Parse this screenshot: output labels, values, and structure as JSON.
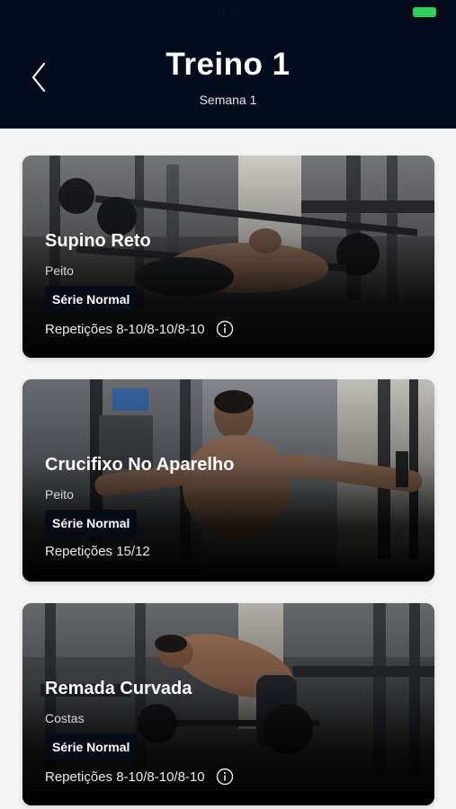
{
  "status": {
    "time": "11:09"
  },
  "header": {
    "title": "Treino 1",
    "subtitle": "Semana 1"
  },
  "exercises": [
    {
      "name": "Supino Reto",
      "muscle": "Peito",
      "series_type": "Série Normal",
      "reps": "Repetições 8-10/8-10/8-10",
      "has_info": true
    },
    {
      "name": "Crucifixo No Aparelho",
      "muscle": "Peito",
      "series_type": "Série Normal",
      "reps": "Repetições 15/12",
      "has_info": false
    },
    {
      "name": "Remada Curvada",
      "muscle": "Costas",
      "series_type": "Série Normal",
      "reps": "Repetições 8-10/8-10/8-10",
      "has_info": true
    }
  ],
  "icons": {
    "back": "chevron-left-icon",
    "info": "info-circle-icon",
    "battery": "battery-icon"
  },
  "colors": {
    "header_bg": "#030b1d",
    "badge_bg": "#060b16",
    "battery": "#2fd05a"
  }
}
